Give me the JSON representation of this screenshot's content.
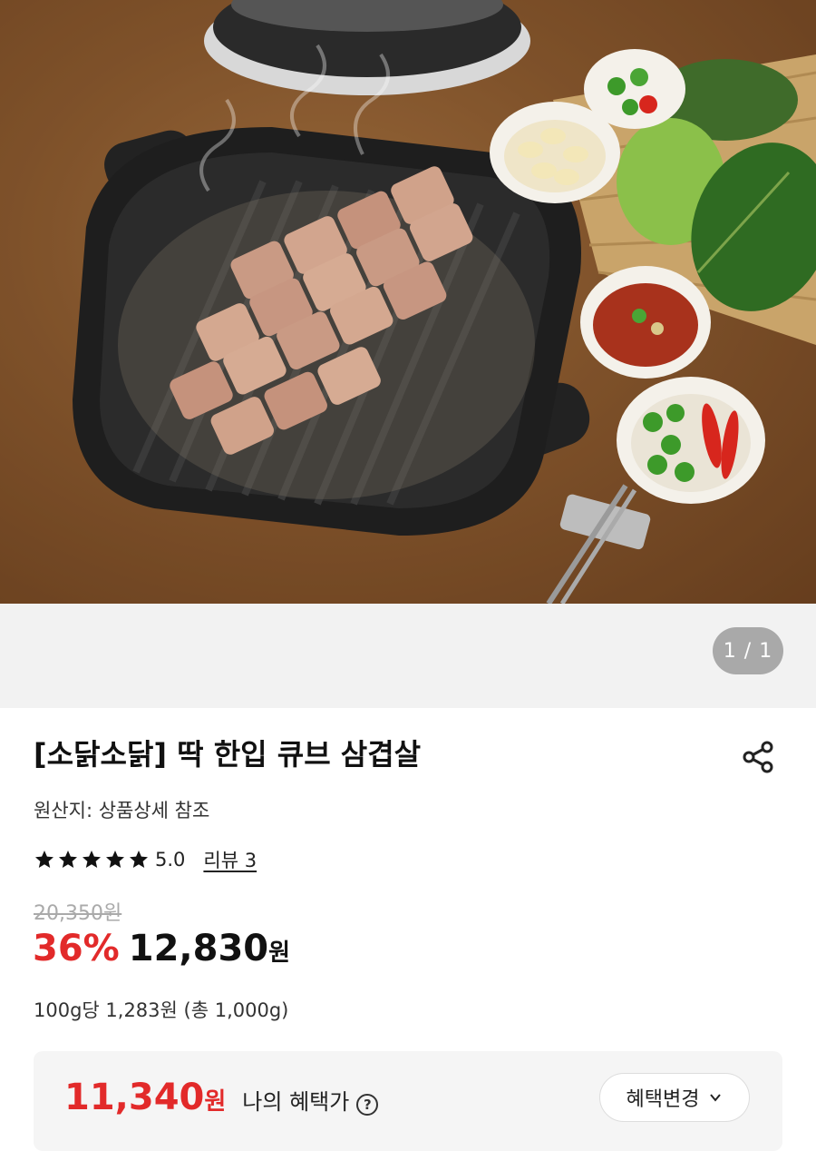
{
  "gallery": {
    "image_alt": "grilled cubed pork belly on cast iron pan with banchan",
    "current": "1",
    "total": "1",
    "indicator": "1 / 1"
  },
  "product": {
    "title": "[소닭소닭] 딱 한입 큐브 삼겹살",
    "origin": "원산지: 상품상세 참조",
    "rating": 5.0,
    "rating_text": "5.0",
    "review_label": "리뷰 3",
    "original_price": "20,350원",
    "discount": "36%",
    "price": "12,830",
    "price_unit": "원",
    "unit_price": "100g당 1,283원 (총 1,000g)"
  },
  "benefit": {
    "price": "11,340",
    "unit": "원",
    "label": "나의 혜택가",
    "help_glyph": "?",
    "change_button": "혜택변경"
  },
  "colors": {
    "accent_red": "#e22a2a",
    "indicator_bg": "#a9a9a9"
  },
  "icons": {
    "share": "share-icon",
    "star": "star-icon",
    "help": "help-circle-icon",
    "chevron": "chevron-down-icon"
  }
}
